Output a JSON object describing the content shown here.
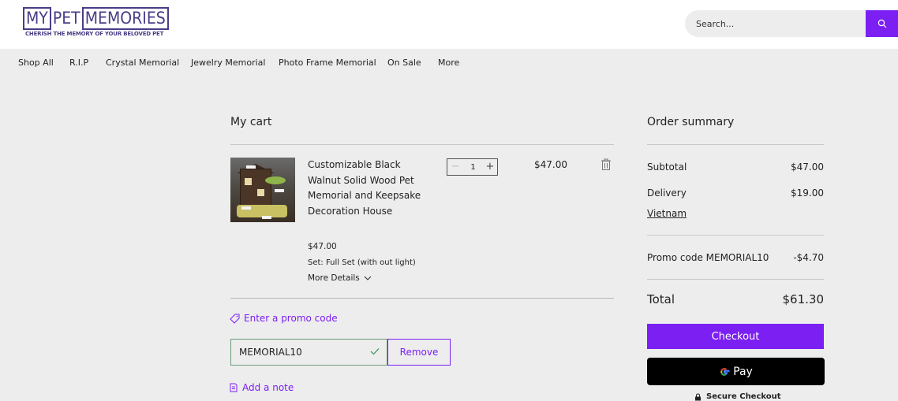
{
  "header": {
    "logo_parts": [
      "MY",
      "PET",
      "MEMORIES"
    ],
    "logo_tagline": "CHERISH THE MEMORY OF YOUR BELOVED PET",
    "search_placeholder": "Search..."
  },
  "nav": {
    "items": [
      "Shop All",
      "R.I.P",
      "Crystal Memorial",
      "Jewelry Memorial",
      "Photo Frame Memorial",
      "On Sale",
      "More"
    ]
  },
  "cart": {
    "title": "My cart",
    "item": {
      "name": "Customizable Black Walnut Solid Wood Pet Memorial and Keepsake Decoration House",
      "unit_price": "$47.00",
      "option": "Set: Full Set (with out light)",
      "more_details": "More Details",
      "quantity": "1",
      "quantity_minus": "−",
      "quantity_plus": "+",
      "line_total": "$47.00"
    },
    "promo_link": "Enter a promo code",
    "promo_value": "MEMORIAL10",
    "remove_label": "Remove",
    "note_link": "Add a note"
  },
  "summary": {
    "title": "Order summary",
    "subtotal_label": "Subtotal",
    "subtotal_value": "$47.00",
    "delivery_label": "Delivery",
    "delivery_value": "$19.00",
    "delivery_location": "Vietnam",
    "promo_label": "Promo code MEMORIAL10",
    "promo_value": "-$4.70",
    "total_label": "Total",
    "total_value": "$61.30",
    "checkout_label": "Checkout",
    "gpay_label": "Pay",
    "secure_label": "Secure Checkout"
  },
  "colors": {
    "accent": "#7b1ff3",
    "brand": "#4a3d86",
    "background": "#ededed"
  }
}
